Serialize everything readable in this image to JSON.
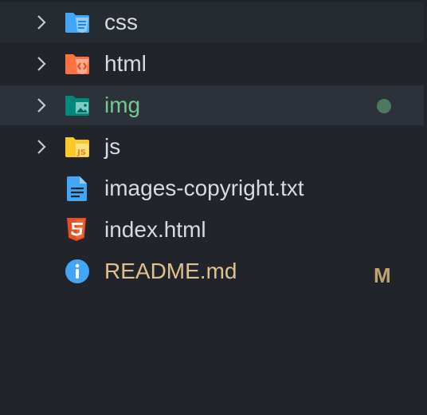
{
  "explorer": {
    "items": [
      {
        "kind": "folder",
        "icon": "folder-css-icon",
        "label": "css",
        "state": "collapsed"
      },
      {
        "kind": "folder",
        "icon": "folder-html-icon",
        "label": "html",
        "state": "collapsed"
      },
      {
        "kind": "folder",
        "icon": "folder-images-icon",
        "label": "img",
        "state": "collapsed",
        "git_status": "untracked"
      },
      {
        "kind": "folder",
        "icon": "folder-javascript-icon",
        "label": "js",
        "state": "collapsed"
      },
      {
        "kind": "file",
        "icon": "text-document-icon",
        "label": "images-copyright.txt"
      },
      {
        "kind": "file",
        "icon": "html5-icon",
        "label": "index.html"
      },
      {
        "kind": "file",
        "icon": "info-icon",
        "label": "README.md",
        "git_status": "modified",
        "status_letter": "M"
      }
    ]
  },
  "colors": {
    "background": "#21252b",
    "selected_row": "#2c313a",
    "default_text": "#d7dae0",
    "untracked_text": "#73c991",
    "modified_text": "#e2c08d",
    "css_folder": "#42a5f5",
    "html_folder": "#ff7043",
    "images_folder": "#009688",
    "js_folder": "#ffca28",
    "html5": "#e44d26",
    "info": "#42a5f5"
  }
}
